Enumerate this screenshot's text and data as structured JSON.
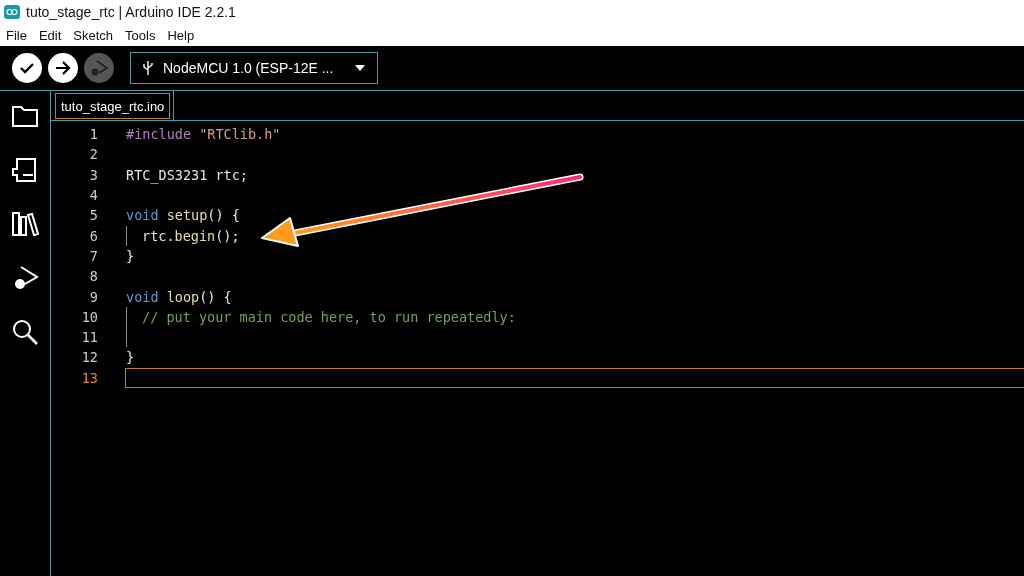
{
  "window": {
    "title": "tuto_stage_rtc | Arduino IDE 2.2.1"
  },
  "menu": [
    "File",
    "Edit",
    "Sketch",
    "Tools",
    "Help"
  ],
  "toolbar": {
    "buttons": [
      {
        "kind": "verify",
        "disabled": false
      },
      {
        "kind": "upload",
        "disabled": false
      },
      {
        "kind": "debug",
        "disabled": true
      }
    ],
    "board": "NodeMCU 1.0 (ESP-12E ..."
  },
  "sidebar": {
    "items": [
      {
        "kind": "sketchbook"
      },
      {
        "kind": "boards"
      },
      {
        "kind": "library"
      },
      {
        "kind": "debug"
      },
      {
        "kind": "search"
      }
    ]
  },
  "tabs": [
    {
      "label": "tuto_stage_rtc.ino",
      "selected": true
    }
  ],
  "editor": {
    "lines": [
      {
        "number": "1",
        "current": false,
        "guide": false,
        "tokens": [
          {
            "kind": "preprocessor",
            "text": "#include "
          },
          {
            "kind": "string",
            "text": "\"RTClib.h\""
          }
        ]
      },
      {
        "number": "2",
        "current": false,
        "guide": false
      },
      {
        "number": "3",
        "current": false,
        "guide": false,
        "tokens": [
          {
            "kind": "plain",
            "text": "RTC_DS3231 rtc;"
          }
        ]
      },
      {
        "number": "4",
        "current": false,
        "guide": false
      },
      {
        "number": "5",
        "current": false,
        "guide": false,
        "tokens": [
          {
            "kind": "keyword",
            "text": "void "
          },
          {
            "kind": "function",
            "text": "setup"
          },
          {
            "kind": "plain",
            "text": "() {"
          }
        ]
      },
      {
        "number": "6",
        "current": false,
        "guide": true,
        "tokens": [
          {
            "kind": "plain",
            "text": "rtc."
          },
          {
            "kind": "function",
            "text": "begin"
          },
          {
            "kind": "plain",
            "text": "();"
          }
        ]
      },
      {
        "number": "7",
        "current": false,
        "guide": false,
        "tokens": [
          {
            "kind": "plain",
            "text": "}"
          }
        ]
      },
      {
        "number": "8",
        "current": false,
        "guide": false
      },
      {
        "number": "9",
        "current": false,
        "guide": false,
        "tokens": [
          {
            "kind": "keyword",
            "text": "void "
          },
          {
            "kind": "function",
            "text": "loop"
          },
          {
            "kind": "plain",
            "text": "() {"
          }
        ]
      },
      {
        "number": "10",
        "current": false,
        "guide": true,
        "tokens": [
          {
            "kind": "comment",
            "text": "// put your main code here, to run repeatedly:"
          }
        ]
      },
      {
        "number": "11",
        "current": false,
        "guide": true
      },
      {
        "number": "12",
        "current": false,
        "guide": false,
        "tokens": [
          {
            "kind": "plain",
            "text": "}"
          }
        ]
      },
      {
        "number": "13",
        "current": true,
        "guide": false
      }
    ]
  }
}
